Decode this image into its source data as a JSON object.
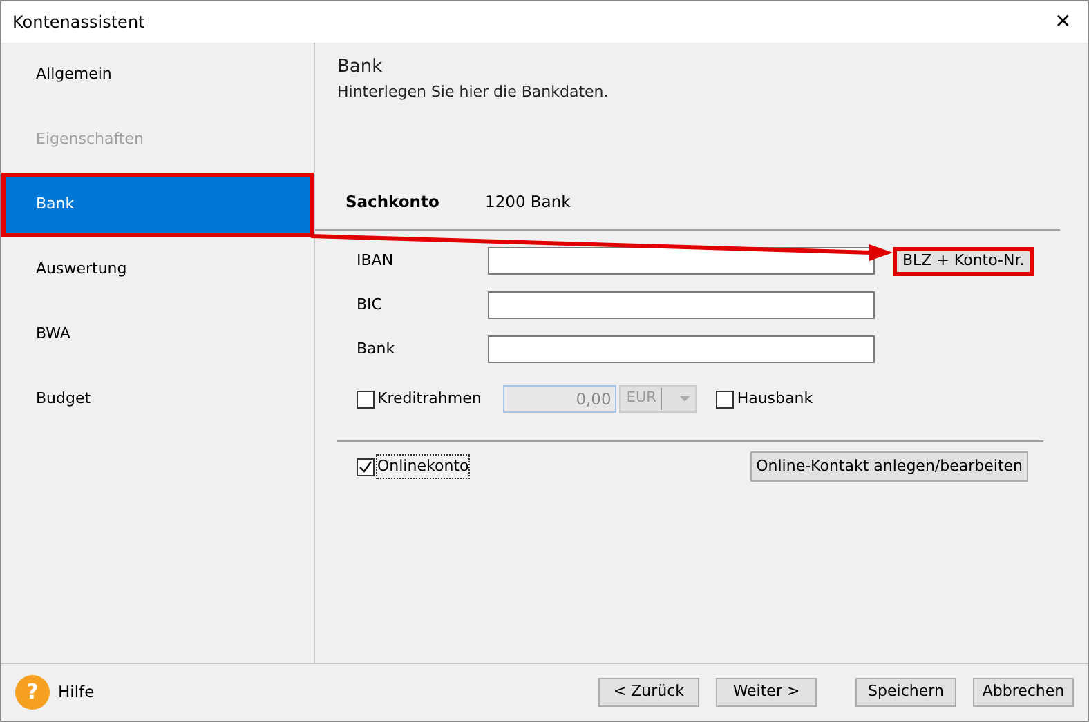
{
  "window": {
    "title": "Kontenassistent",
    "close": "✕"
  },
  "sidebar": {
    "items": [
      {
        "label": "Allgemein",
        "selected": false,
        "disabled": false,
        "highlighted": false
      },
      {
        "label": "Eigenschaften",
        "selected": false,
        "disabled": true,
        "highlighted": false
      },
      {
        "label": "Bank",
        "selected": true,
        "disabled": false,
        "highlighted": true
      },
      {
        "label": "Auswertung",
        "selected": false,
        "disabled": false,
        "highlighted": false
      },
      {
        "label": "BWA",
        "selected": false,
        "disabled": false,
        "highlighted": false
      },
      {
        "label": "Budget",
        "selected": false,
        "disabled": false,
        "highlighted": false
      }
    ]
  },
  "page": {
    "title": "Bank",
    "subtitle": "Hinterlegen Sie hier die Bankdaten."
  },
  "account": {
    "label": "Sachkonto",
    "value": "1200 Bank"
  },
  "fields": [
    {
      "label": "IBAN"
    },
    {
      "label": "BIC"
    },
    {
      "label": "Bank"
    }
  ],
  "blz_button": {
    "label": "BLZ + Konto-Nr.",
    "highlighted": true
  },
  "annotation_arrow": true,
  "credit": {
    "label": "Kreditrahmen",
    "checked": false,
    "value": "0,00",
    "currency": "EUR",
    "disabled": true
  },
  "hausbank": {
    "label": "Hausbank",
    "checked": false
  },
  "online": {
    "label": "Onlinekonto",
    "checked": true,
    "button": "Online-Kontakt anlegen/bearbeiten"
  },
  "footer": {
    "help": "Hilfe",
    "help_icon": "?",
    "buttons": [
      "< Zurück",
      "Weiter >",
      "Speichern",
      "Abbrechen"
    ]
  }
}
